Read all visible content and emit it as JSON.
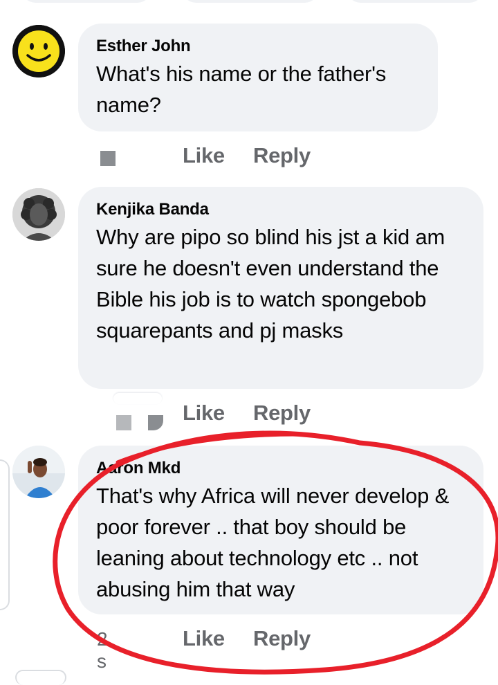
{
  "comments": [
    {
      "name": "Esther John",
      "text": "What's his name or the father's name?",
      "time": "",
      "like_label": "Like",
      "reply_label": "Reply"
    },
    {
      "name": "Kenjika Banda",
      "text": "Why are pipo so blind his jst a kid am sure he doesn't even understand the Bible his job is to watch spongebob squarepants and pj masks",
      "time": "",
      "like_label": "Like",
      "reply_label": "Reply"
    },
    {
      "name": "Aaron Mkd",
      "text": "That's why Africa will never develop & poor forever .. that boy should be leaning about technology etc .. not abusing him that way",
      "time": "2 s",
      "like_label": "Like",
      "reply_label": "Reply"
    }
  ],
  "highlight": {
    "color": "#e8202a",
    "shape": "ellipse-annotation"
  },
  "colors": {
    "bubble": "#f0f2f5",
    "action": "#65676b",
    "text": "#050505"
  }
}
